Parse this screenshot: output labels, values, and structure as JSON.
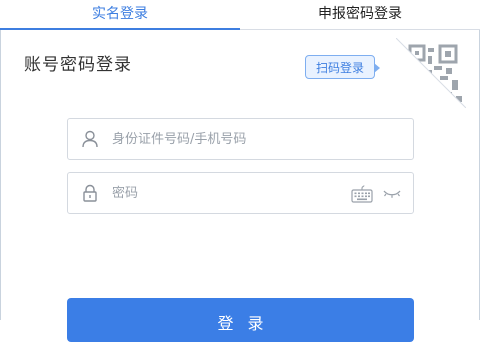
{
  "tabs": [
    {
      "label": "实名登录",
      "active": true
    },
    {
      "label": "申报密码登录",
      "active": false
    }
  ],
  "login": {
    "title": "账号密码登录",
    "qr_tip": "扫码登录",
    "username": {
      "placeholder": "身份证件号码/手机号码",
      "value": ""
    },
    "password": {
      "placeholder": "密码",
      "value": ""
    },
    "submit_label": "登录"
  },
  "icons": {
    "user": "user-icon",
    "lock": "lock-icon",
    "keyboard": "keyboard-icon",
    "eye": "eye-closed-icon",
    "qr": "qr-code-icon"
  },
  "colors": {
    "accent": "#3d7ee0",
    "button": "#3b7ee6",
    "tip_bg": "#e9f2ff",
    "border": "#d4d9e0"
  }
}
